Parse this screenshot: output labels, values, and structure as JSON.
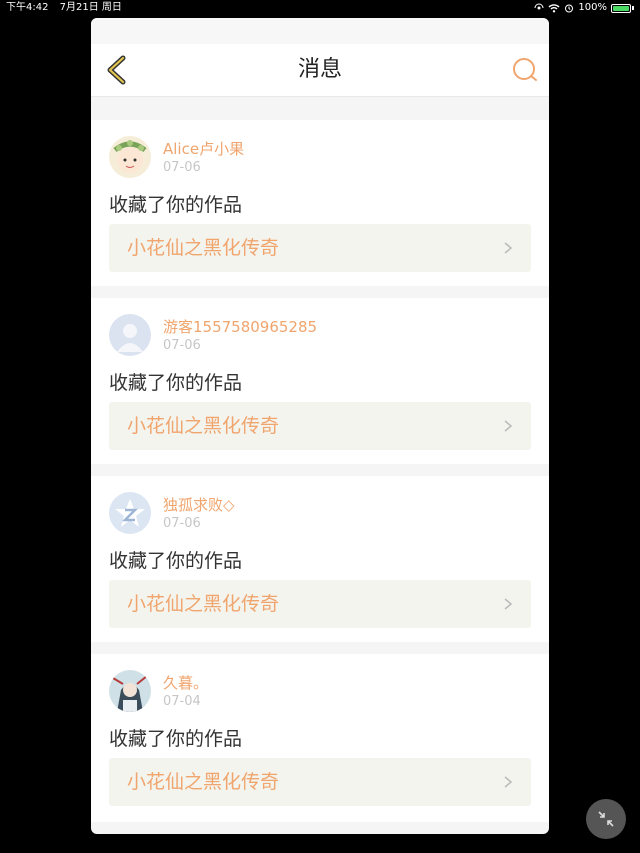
{
  "statusbar": {
    "time": "下午4:42",
    "date": "7月21日 周日",
    "battery": "100%"
  },
  "navbar": {
    "title": "消息",
    "back_icon": "chevron-left-icon",
    "search_icon": "search-icon"
  },
  "colors": {
    "accent": "#f0a56e",
    "page_bg": "#f5f5f5",
    "card_bg": "#ffffff",
    "link_bg": "#f4f4ee"
  },
  "notifications": [
    {
      "user": "Alice卢小果",
      "date": "07-06",
      "action": "收藏了你的作品",
      "work": "小花仙之黑化传奇",
      "avatar": "avatar-anime-flower-crown"
    },
    {
      "user": "游客1557580965285",
      "date": "07-06",
      "action": "收藏了你的作品",
      "work": "小花仙之黑化传奇",
      "avatar": "avatar-default-person"
    },
    {
      "user": "独孤求败◇",
      "date": "07-06",
      "action": "收藏了你的作品",
      "work": "小花仙之黑化传奇",
      "avatar": "avatar-star-logo"
    },
    {
      "user": "久暮。",
      "date": "07-04",
      "action": "收藏了你的作品",
      "work": "小花仙之黑化传奇",
      "avatar": "avatar-anime-character"
    }
  ],
  "fab_icon": "collapse-icon"
}
